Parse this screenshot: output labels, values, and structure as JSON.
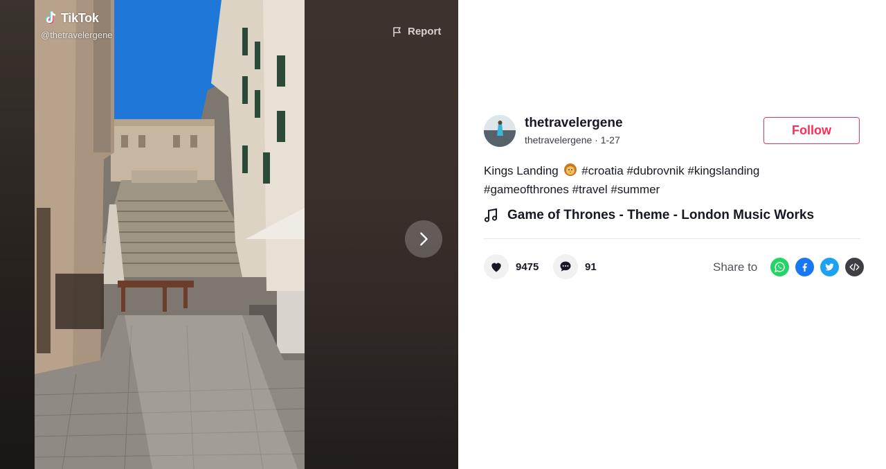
{
  "brand": {
    "logo_text": "TikTok",
    "watermark_handle": "@thetravelergene"
  },
  "video": {
    "report_label": "Report",
    "next_icon": "chevron-right-icon"
  },
  "author": {
    "username": "thetravelergene",
    "subline": "thetravelergene · 1-27"
  },
  "follow_label": "Follow",
  "description": {
    "text": "Kings Landing",
    "emoji": "lion-emoji",
    "hashtags_line1": [
      "#croatia",
      "#dubrovnik",
      "#kingslanding"
    ],
    "hashtags_line2": [
      "#gameofthrones",
      "#travel",
      "#summer"
    ]
  },
  "music": {
    "title": "Game of Thrones - Theme - London Music Works"
  },
  "stats": {
    "likes": "9475",
    "comments": "91"
  },
  "share": {
    "label": "Share to",
    "targets": [
      "whatsapp",
      "facebook",
      "twitter",
      "embed"
    ]
  },
  "colors": {
    "accent": "#fe2c55",
    "whatsapp": "#25d366",
    "facebook": "#1877f2",
    "twitter": "#1da1f2",
    "embed": "#3e3e44"
  }
}
